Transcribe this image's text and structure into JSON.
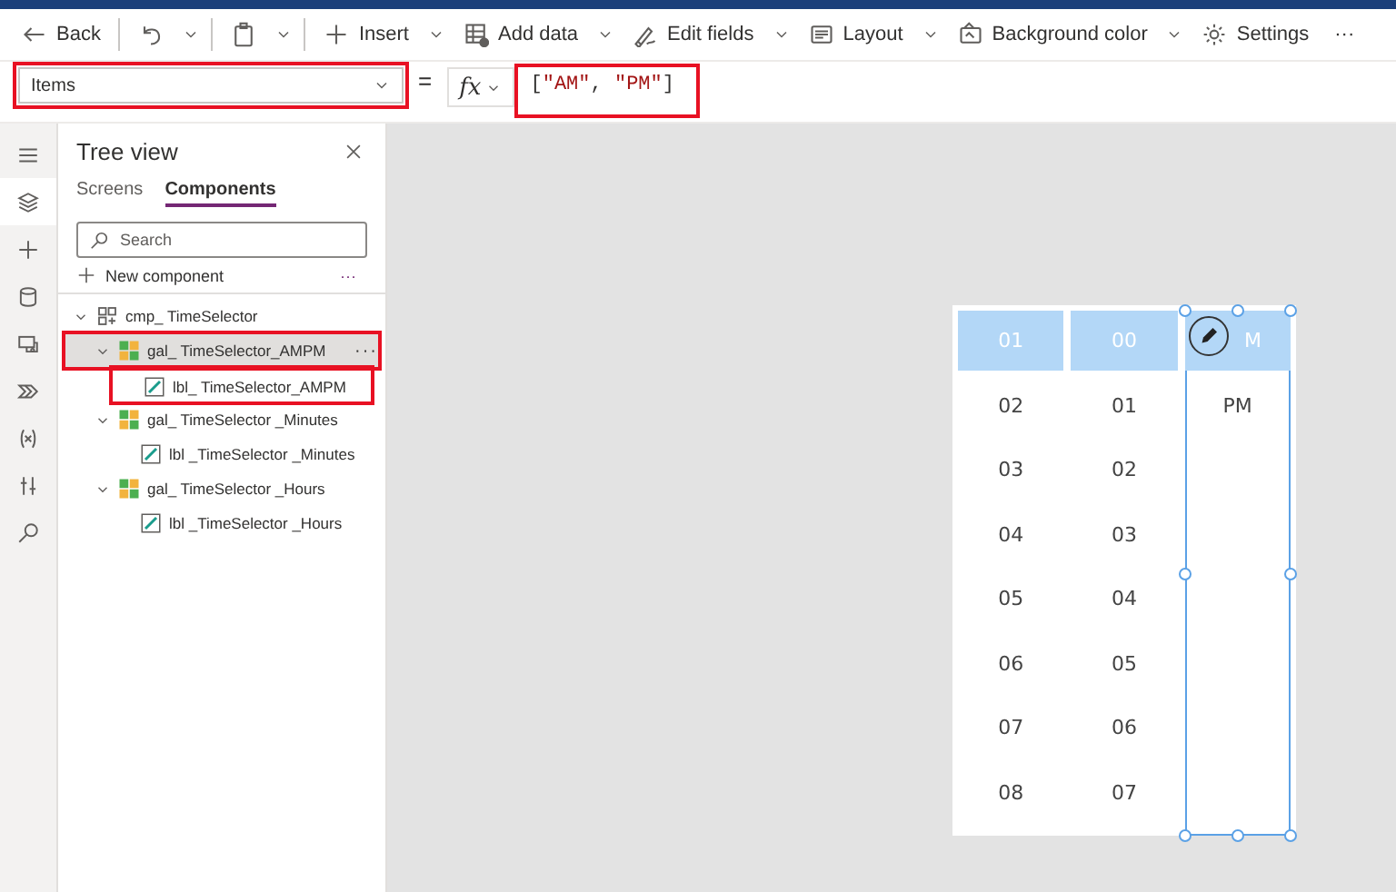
{
  "toolbar": {
    "items": [
      {
        "kind": "back",
        "label": "Back",
        "caret": false
      },
      {
        "kind": "undo",
        "caret": true
      },
      {
        "kind": "paste",
        "caret": true
      },
      {
        "kind": "plus",
        "label": "Insert",
        "caret": true
      },
      {
        "kind": "table",
        "label": "Add data",
        "caret": true
      },
      {
        "kind": "pen",
        "label": "Edit fields",
        "caret": true
      },
      {
        "kind": "layout",
        "label": "Layout",
        "caret": true
      },
      {
        "kind": "palette",
        "label": "Background color",
        "caret": true
      },
      {
        "kind": "gear",
        "label": "Settings",
        "caret": false
      },
      {
        "kind": "more",
        "label": "···",
        "caret": false
      }
    ]
  },
  "formula_bar": {
    "property": "Items",
    "property_highlighted": true,
    "equals": "=",
    "fx": "fx",
    "formula_highlighted": true,
    "formula": [
      {
        "kind": "punct",
        "text": "["
      },
      {
        "kind": "string",
        "text": "\"AM\""
      },
      {
        "kind": "punct",
        "text": ", "
      },
      {
        "kind": "string",
        "text": "\"PM\""
      },
      {
        "kind": "punct",
        "text": "]"
      }
    ]
  },
  "rail": {
    "items": [
      {
        "kind": "menu",
        "selected": false
      },
      {
        "kind": "layers",
        "selected": true
      },
      {
        "kind": "plus",
        "selected": false
      },
      {
        "kind": "database",
        "selected": false
      },
      {
        "kind": "media",
        "selected": false
      },
      {
        "kind": "theme",
        "selected": false
      },
      {
        "kind": "variable",
        "selected": false
      },
      {
        "kind": "tools",
        "selected": false
      },
      {
        "kind": "search",
        "selected": false
      }
    ]
  },
  "tree_view": {
    "title": "Tree view",
    "tabs": [
      {
        "label": "Screens",
        "selected": false
      },
      {
        "label": "Components",
        "selected": true
      }
    ],
    "search": {
      "placeholder": "Search"
    },
    "new_component": "New component",
    "more": "···",
    "nodes": [
      {
        "kind": "component",
        "label": "cmp_ TimeSelector",
        "expanded": true,
        "selected": false,
        "highlighted": false,
        "children": [
          {
            "kind": "gallery",
            "label": "gal_ TimeSelector_AMPM",
            "expanded": true,
            "selected": true,
            "highlighted": true,
            "more": "···",
            "children": [
              {
                "kind": "label",
                "label": "lbl_ TimeSelector_AMPM",
                "selected": false,
                "highlighted": true
              }
            ]
          },
          {
            "kind": "gallery",
            "label": "gal_ TimeSelector _Minutes",
            "expanded": true,
            "selected": false,
            "highlighted": false,
            "children": [
              {
                "kind": "label",
                "label": "lbl _TimeSelector _Minutes",
                "selected": false,
                "highlighted": false
              }
            ]
          },
          {
            "kind": "gallery",
            "label": "gal_ TimeSelector _Hours",
            "expanded": true,
            "selected": false,
            "highlighted": false,
            "children": [
              {
                "kind": "label",
                "label": "lbl _TimeSelector _Hours",
                "selected": false,
                "highlighted": false
              }
            ]
          }
        ]
      }
    ]
  },
  "canvas": {
    "columns": [
      {
        "selected": false,
        "items": [
          {
            "text": "01",
            "selected": true
          },
          {
            "text": "02",
            "selected": false
          },
          {
            "text": "03",
            "selected": false
          },
          {
            "text": "04",
            "selected": false
          },
          {
            "text": "05",
            "selected": false
          },
          {
            "text": "06",
            "selected": false
          },
          {
            "text": "07",
            "selected": false
          },
          {
            "text": "08",
            "selected": false
          }
        ]
      },
      {
        "selected": false,
        "items": [
          {
            "text": "00",
            "selected": true
          },
          {
            "text": "01",
            "selected": false
          },
          {
            "text": "02",
            "selected": false
          },
          {
            "text": "03",
            "selected": false
          },
          {
            "text": "04",
            "selected": false
          },
          {
            "text": "05",
            "selected": false
          },
          {
            "text": "06",
            "selected": false
          },
          {
            "text": "07",
            "selected": false
          }
        ]
      },
      {
        "selected": true,
        "edit_icon": true,
        "items": [
          {
            "text": "M",
            "selected": true
          },
          {
            "text": "PM",
            "selected": false
          }
        ]
      }
    ]
  }
}
